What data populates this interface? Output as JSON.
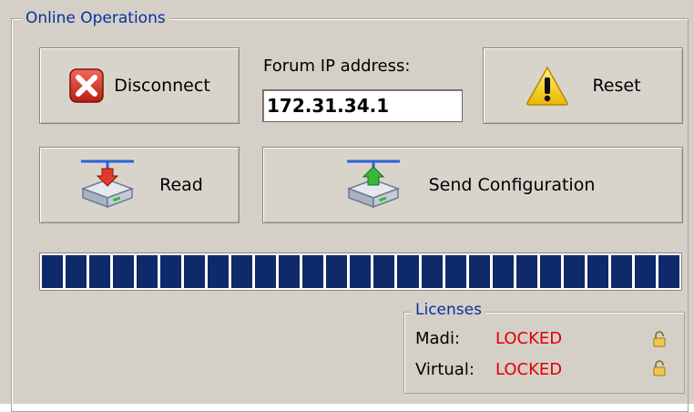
{
  "panel": {
    "title": "Online Operations",
    "buttons": {
      "disconnect": "Disconnect",
      "reset": "Reset",
      "read": "Read",
      "send": "Send Configuration"
    },
    "ip": {
      "label": "Forum IP address:",
      "value": "172.31.34.1"
    },
    "progress": {
      "segments": 27,
      "fraction": 1.0
    },
    "licenses": {
      "title": "Licenses",
      "rows": [
        {
          "label": "Madi:",
          "status": "LOCKED",
          "icon": "lock-icon"
        },
        {
          "label": "Virtual:",
          "status": "LOCKED",
          "icon": "lock-icon"
        }
      ]
    },
    "colors": {
      "title": "#0a2f9c",
      "locked": "#e10000",
      "progress": "#0f2a6b"
    }
  }
}
